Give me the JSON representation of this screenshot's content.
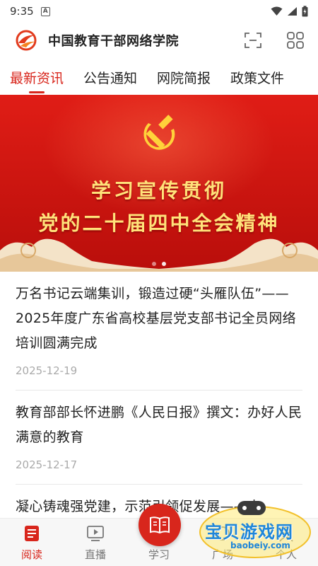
{
  "status_bar": {
    "time": "9:35",
    "sim_badge": "A"
  },
  "header": {
    "app_title": "中国教育干部网络学院",
    "brand_color": "#d8261c"
  },
  "tabs": [
    {
      "label": "最新资讯",
      "active": true
    },
    {
      "label": "公告通知",
      "active": false
    },
    {
      "label": "网院简报",
      "active": false
    },
    {
      "label": "政策文件",
      "active": false
    }
  ],
  "banner": {
    "line1": "学习宣传贯彻",
    "line2": "党的二十届四中全会精神",
    "slide_count": 2,
    "active_slide": 2
  },
  "news": [
    {
      "title": "万名书记云端集训，锻造过硬“头雁队伍”——2025年度广东省高校基层党支部书记全员网络培训圆满完成",
      "date": "2025-12-19"
    },
    {
      "title": "教育部部长怀进鹏《人民日报》撰文：办好人民满意的教育",
      "date": "2025-12-17"
    },
    {
      "title": "凝心铸魂强党建，示范引领促发展——中",
      "date": ""
    }
  ],
  "bottom_nav": {
    "read": "阅读",
    "live": "直播",
    "study": "学习",
    "square": "广场",
    "me": "个人"
  },
  "watermark": {
    "text": "宝贝游戏网",
    "url": "baobeiy.com"
  }
}
